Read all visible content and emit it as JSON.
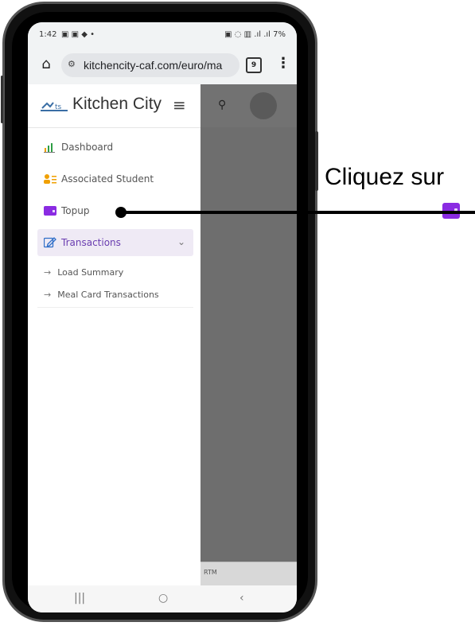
{
  "status_bar": {
    "time": "1:42",
    "indicators": "▣ ▣ ◆ •",
    "right_icons": "▣ ◌ ▥ .ıl .ıl",
    "battery": "7%"
  },
  "browser": {
    "url": "kitchencity-caf.com/euro/ma",
    "tabs_count": "9",
    "icons": {
      "home": "home-icon",
      "site_settings": "tune-icon",
      "tabs": "tabs-icon",
      "menu": "more-vert-icon"
    }
  },
  "sidebar": {
    "brand_name": "Kitchen City",
    "items": [
      {
        "label": "Dashboard",
        "icon": "bar-chart-icon"
      },
      {
        "label": "Associated Student",
        "icon": "students-icon"
      },
      {
        "label": "Topup",
        "icon": "wallet-icon"
      },
      {
        "label": "Transactions",
        "icon": "edit-icon",
        "expanded": true
      }
    ],
    "sub_items": [
      {
        "label": "Load Summary"
      },
      {
        "label": "Meal Card Transactions"
      }
    ]
  },
  "overlay": {
    "footer_text": "RTM"
  },
  "annotation": {
    "text": "Cliquez sur",
    "target_icon": "wallet-icon"
  },
  "colors": {
    "accent_purple": "#8a2be2",
    "overlay": "#6e6e6e",
    "active_bg": "#efeaf5"
  }
}
